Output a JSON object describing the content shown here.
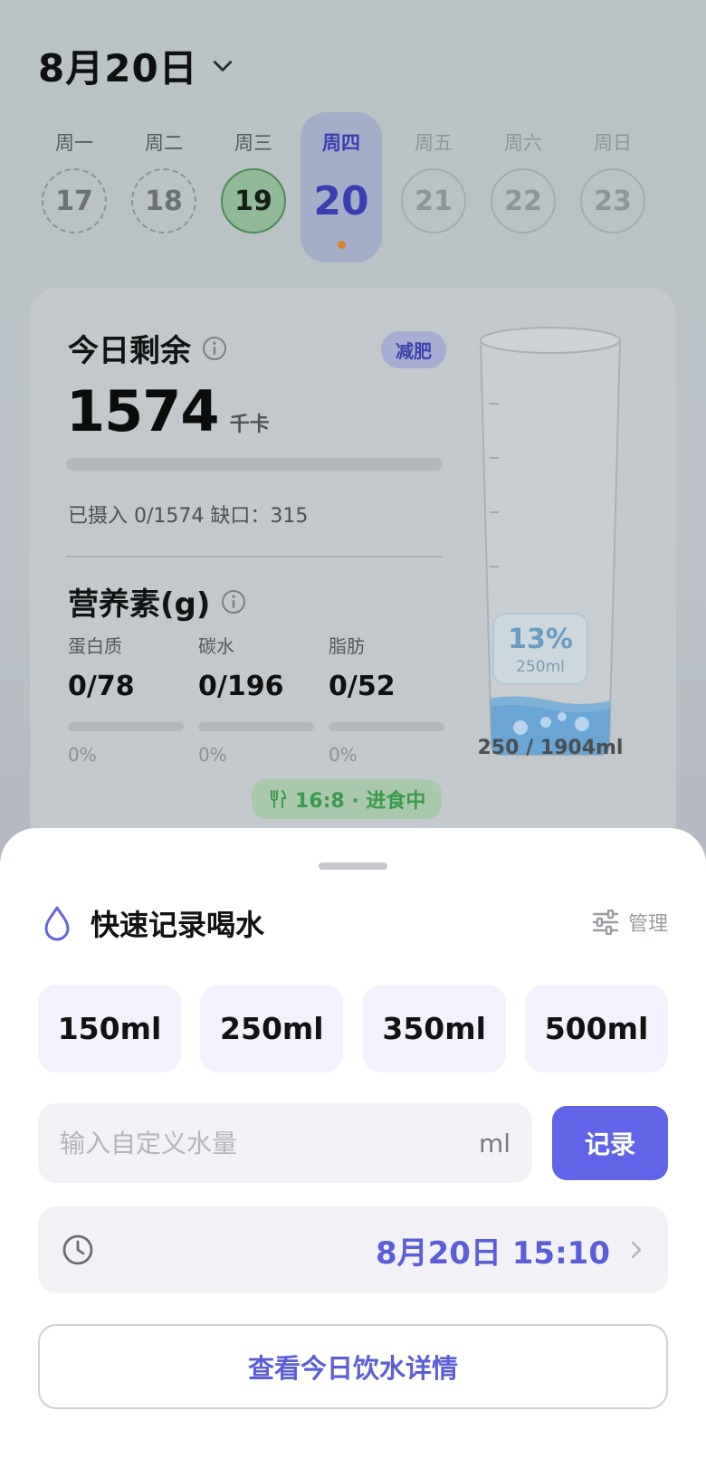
{
  "header": {
    "date": "8月20日"
  },
  "week": [
    {
      "weekday": "周一",
      "day": "17",
      "state": "past"
    },
    {
      "weekday": "周二",
      "day": "18",
      "state": "past"
    },
    {
      "weekday": "周三",
      "day": "19",
      "state": "done"
    },
    {
      "weekday": "周四",
      "day": "20",
      "state": "today"
    },
    {
      "weekday": "周五",
      "day": "21",
      "state": "future"
    },
    {
      "weekday": "周六",
      "day": "22",
      "state": "future"
    },
    {
      "weekday": "周日",
      "day": "23",
      "state": "future"
    }
  ],
  "summary": {
    "remain_title": "今日剩余",
    "goal_badge": "减肥",
    "remain_kcal": "1574",
    "kcal_unit": "千卡",
    "calorie_progress": 0,
    "intake_text": "已摄入 0/1574  缺口：315"
  },
  "nutrients": {
    "title": "营养素(g)",
    "items": [
      {
        "label": "蛋白质",
        "value": "0/78",
        "percent": "0%",
        "progress": 0
      },
      {
        "label": "碳水",
        "value": "0/196",
        "percent": "0%",
        "progress": 0
      },
      {
        "label": "脂肪",
        "value": "0/52",
        "percent": "0%",
        "progress": 0
      }
    ]
  },
  "water": {
    "percent": "13%",
    "amount": "250ml",
    "total": "250 / 1904ml",
    "fill_fraction": 0.13
  },
  "fasting": {
    "label": "16:8 · 进食中"
  },
  "sheet": {
    "title": "快速记录喝水",
    "manage": "管理",
    "quick_amounts": [
      "150ml",
      "250ml",
      "350ml",
      "500ml"
    ],
    "custom_placeholder": "输入自定义水量",
    "custom_unit": "ml",
    "record_label": "记录",
    "time_value": "8月20日 15:10",
    "detail_label": "查看今日饮水详情"
  },
  "colors": {
    "accent": "#6164e6",
    "today_bg": "#a4aec9",
    "done_green": "#8fb997",
    "water": "#4b9bd6"
  }
}
